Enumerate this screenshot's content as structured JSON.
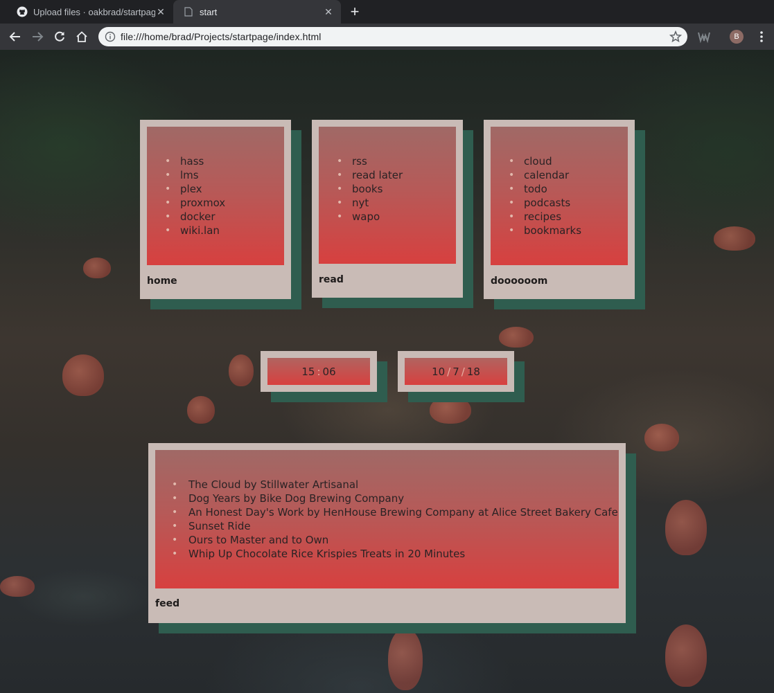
{
  "browser": {
    "tabs": [
      {
        "title": "Upload files · oakbrad/startpage",
        "icon": "github-icon"
      },
      {
        "title": "start",
        "icon": "page-icon"
      }
    ],
    "url": "file:///home/brad/Projects/startpage/index.html",
    "avatar_initial": "B"
  },
  "cards": {
    "home": {
      "caption": "home",
      "links": [
        "hass",
        "lms",
        "plex",
        "proxmox",
        "docker",
        "wiki.lan"
      ]
    },
    "read": {
      "caption": "read",
      "links": [
        "rss",
        "read later",
        "books",
        "nyt",
        "wapo"
      ]
    },
    "do": {
      "caption": "doooooom",
      "links": [
        "cloud",
        "calendar",
        "todo",
        "podcasts",
        "recipes",
        "bookmarks"
      ]
    }
  },
  "clock": {
    "hours": "15",
    "minutes": "06",
    "separator": ":"
  },
  "date": {
    "month": "10",
    "day": "7",
    "year": "18",
    "separator": "/"
  },
  "feed": {
    "caption": "feed",
    "items": [
      "The Cloud by Stillwater Artisanal",
      "Dog Years by Bike Dog Brewing Company",
      "An Honest Day's Work by HenHouse Brewing Company at Alice Street Bakery Cafe",
      "Sunset Ride",
      "Ours to Master and to Own",
      "Whip Up Chocolate Rice Krispies Treats in 20 Minutes"
    ]
  },
  "colors": {
    "card_frame": "#c9bbb6",
    "card_shadow": "#2f5d4f",
    "card_gradient_top": "#a06966",
    "card_gradient_bottom": "#d7403f"
  }
}
